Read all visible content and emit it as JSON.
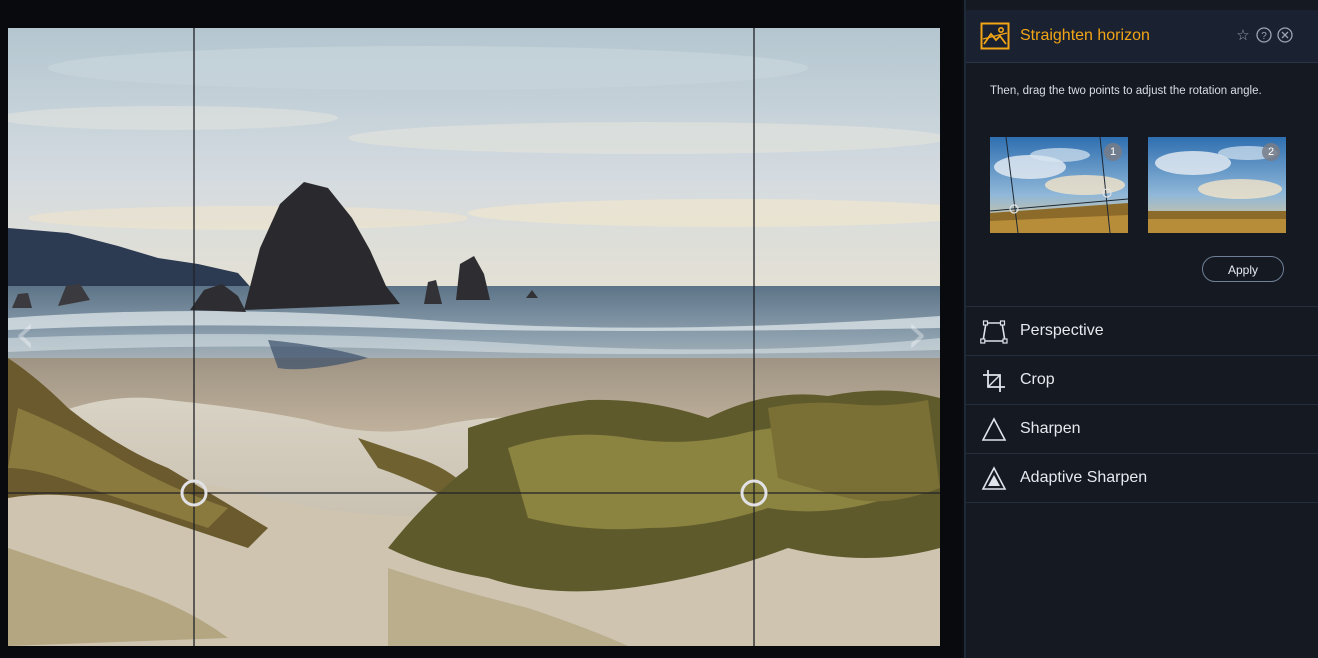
{
  "panel": {
    "title": "Straighten horizon",
    "icons": {
      "title": "horizon-image-icon",
      "favorite": "star-icon",
      "help": "help-icon",
      "close": "close-icon"
    },
    "instructions": "Then, drag the two points to adjust the rotation angle.",
    "examples": [
      {
        "badge": "1"
      },
      {
        "badge": "2"
      }
    ],
    "apply_label": "Apply",
    "tools": [
      {
        "label": "Perspective",
        "icon": "perspective-icon"
      },
      {
        "label": "Crop",
        "icon": "crop-icon"
      },
      {
        "label": "Sharpen",
        "icon": "sharpen-icon"
      },
      {
        "label": "Adaptive Sharpen",
        "icon": "adaptive-sharpen-icon"
      }
    ]
  },
  "canvas": {
    "prev_glyph": "‹",
    "next_glyph": "›",
    "icons": {
      "prev": "chevron-left-icon",
      "next": "chevron-right-icon"
    }
  },
  "colors": {
    "accent": "#f2a516",
    "panel_bg": "#141922",
    "header_bg": "#1a2130"
  }
}
